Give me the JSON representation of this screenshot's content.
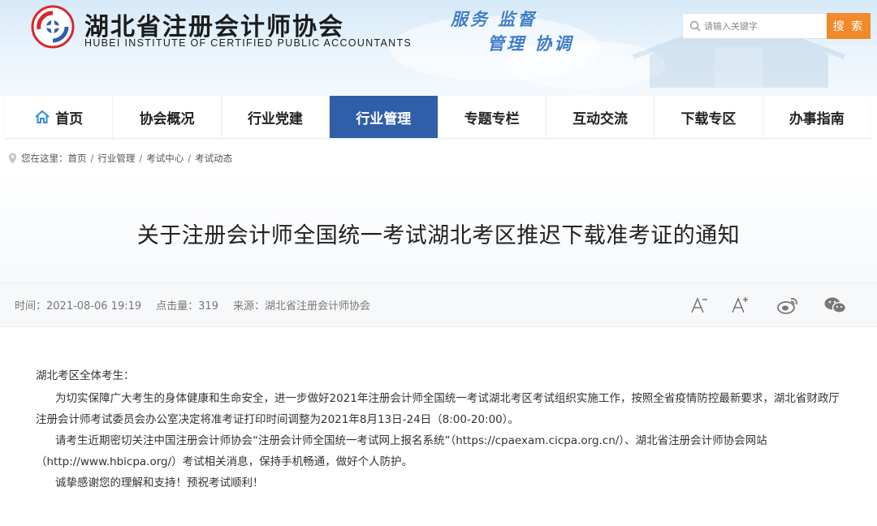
{
  "header": {
    "brand_cn": "湖北省注册会计师协会",
    "brand_en": "HUBEI INSTITUTE OF CERTIFIED PUBLIC ACCOUNTANTS",
    "slogan_line1": "服务 监督",
    "slogan_line2": "管理 协调",
    "search_placeholder": "请输入关键字",
    "search_button": "搜 索",
    "accent_color": "#f08a2b"
  },
  "nav": {
    "active_color": "#2f5fa8",
    "items": [
      {
        "label": "首页"
      },
      {
        "label": "协会概况"
      },
      {
        "label": "行业党建"
      },
      {
        "label": "行业管理"
      },
      {
        "label": "专题专栏"
      },
      {
        "label": "互动交流"
      },
      {
        "label": "下载专区"
      },
      {
        "label": "办事指南"
      }
    ]
  },
  "breadcrumb": {
    "prefix": "您在这里：",
    "items": [
      "首页",
      "行业管理",
      "考试中心",
      "考试动态"
    ]
  },
  "article": {
    "title": "关于注册会计师全国统一考试湖北考区推迟下载准考证的通知",
    "time": "时间：2021-08-06 19:19",
    "clicks": "点击量：319",
    "source": "来源：湖北省注册会计师协会",
    "tools": [
      "font-decrease-icon",
      "font-increase-icon",
      "weibo-icon",
      "wechat-icon"
    ],
    "salutation": "湖北考区全体考生：",
    "paragraphs": [
      "为切实保障广大考生的身体健康和生命安全，进一步做好2021年注册会计师全国统一考试湖北考区考试组织实施工作，按照全省疫情防控最新要求，湖北省财政厅注册会计师考试委员会办公室决定将准考证打印时间调整为2021年8月13日-24日（8:00-20:00）。",
      "请考生近期密切关注中国注册会计师协会“注册会计师全国统一考试网上报名系统”（https://cpaexam.cicpa.org.cn/）、湖北省注册会计师协会网站（http://www.hbicpa.org/）考试相关消息，保持手机畅通，做好个人防护。",
      "诚挚感谢您的理解和支持！预祝考试顺利！"
    ]
  }
}
